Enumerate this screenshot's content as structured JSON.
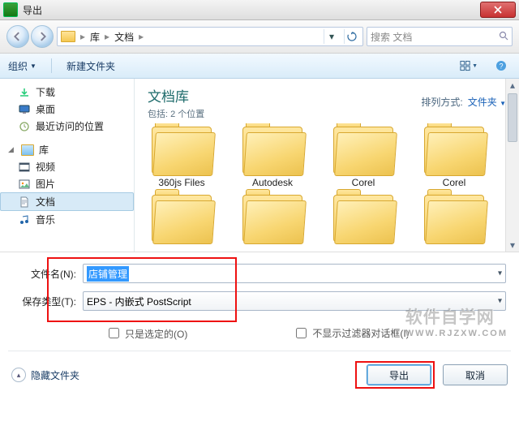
{
  "window": {
    "title": "导出"
  },
  "breadcrumb": {
    "root": "库",
    "current": "文档"
  },
  "search": {
    "placeholder": "搜索 文档"
  },
  "toolbar": {
    "organize": "组织",
    "new_folder": "新建文件夹"
  },
  "sidebar": {
    "downloads": "下载",
    "desktop": "桌面",
    "recent": "最近访问的位置",
    "libraries": "库",
    "videos": "视频",
    "pictures": "图片",
    "documents": "文档",
    "music": "音乐"
  },
  "library": {
    "title": "文档库",
    "subtitle": "包括: 2 个位置",
    "arrange_label": "排列方式:",
    "arrange_value": "文件夹"
  },
  "folders": {
    "row1": [
      "360js Files",
      "Autodesk",
      "Corel",
      "Corel"
    ]
  },
  "form": {
    "filename_label": "文件名(N):",
    "filename_value": "店铺管理",
    "type_label": "保存类型(T):",
    "type_value": "EPS - 内嵌式 PostScript"
  },
  "options": {
    "selected_only": "只是选定的(O)",
    "no_filter_dialog": "不显示过滤器对话框(I)"
  },
  "footer": {
    "hide_folders": "隐藏文件夹",
    "export": "导出",
    "cancel": "取消"
  },
  "watermark": {
    "main": "软件自学网",
    "sub": "WWW.RJZXW.COM"
  }
}
